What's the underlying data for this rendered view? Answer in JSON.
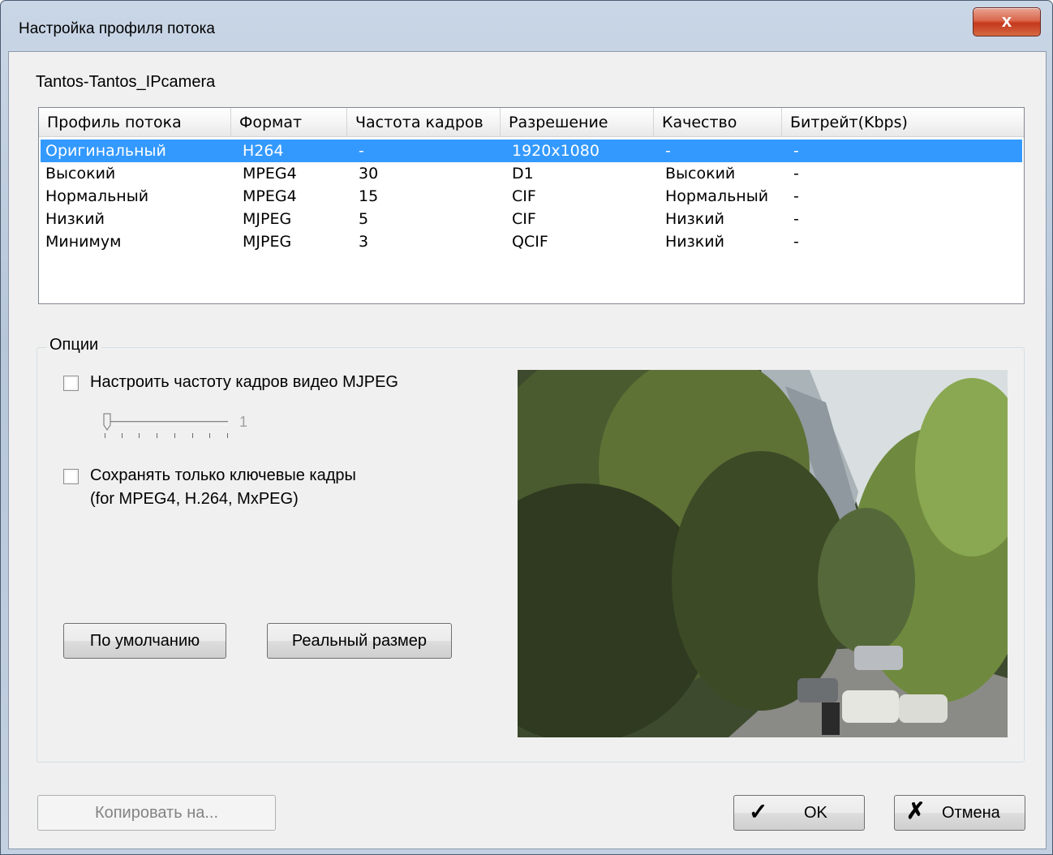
{
  "window": {
    "title": "Настройка профиля потока",
    "close_glyph": "x"
  },
  "camera_name": "Tantos-Tantos_IPcamera",
  "stream_table": {
    "columns": [
      "Профиль потока",
      "Формат",
      "Частота кадров",
      "Разрешение",
      "Качество",
      "Битрейт(Kbps)"
    ],
    "rows": [
      {
        "profile": "Оригинальный",
        "format": "H264",
        "fps": "-",
        "resolution": "1920x1080",
        "quality": "-",
        "bitrate": "-",
        "selected": true
      },
      {
        "profile": "Высокий",
        "format": "MPEG4",
        "fps": "30",
        "resolution": "D1",
        "quality": "Высокий",
        "bitrate": "-"
      },
      {
        "profile": "Нормальный",
        "format": "MPEG4",
        "fps": "15",
        "resolution": "CIF",
        "quality": "Нормальный",
        "bitrate": "-"
      },
      {
        "profile": "Низкий",
        "format": "MJPEG",
        "fps": "5",
        "resolution": "CIF",
        "quality": "Низкий",
        "bitrate": "-"
      },
      {
        "profile": "Минимум",
        "format": "MJPEG",
        "fps": "3",
        "resolution": "QCIF",
        "quality": "Низкий",
        "bitrate": "-"
      }
    ]
  },
  "options": {
    "group_label": "Опции",
    "mjpeg_fps": {
      "label": "Настроить частоту кадров видео MJPEG",
      "checked": false,
      "slider_value": "1"
    },
    "keyframes": {
      "label_line1": "Сохранять только ключевые кадры",
      "label_line2": "(for MPEG4, H.264, MxPEG)",
      "checked": false
    },
    "default_button": "По умолчанию",
    "real_size_button": "Реальный размер",
    "preview_icon": "camera-preview-image"
  },
  "footer": {
    "copy_button": "Копировать на...",
    "ok_button": "OK",
    "cancel_button": "Отмена",
    "ok_icon": "checkmark-icon",
    "cancel_icon": "x-icon"
  },
  "colors": {
    "selection": "#3399ff",
    "dialog_bg": "#f0f0f0",
    "close_button": "#c7432a"
  }
}
